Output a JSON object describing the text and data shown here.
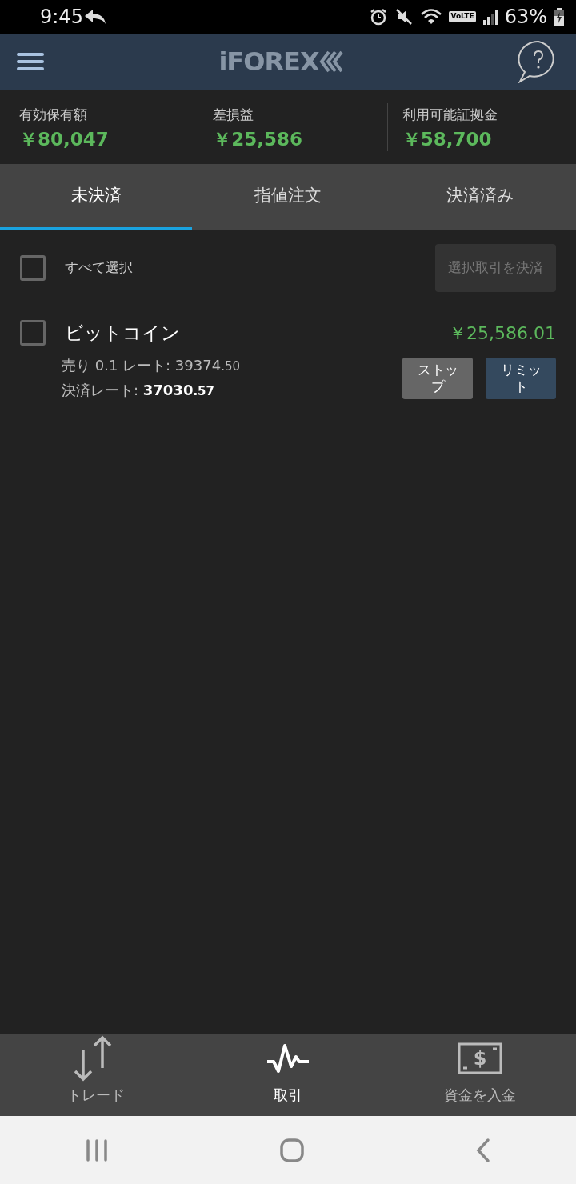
{
  "status_bar": {
    "time": "9:45",
    "network": "VoLTE",
    "battery": "63%"
  },
  "header": {
    "logo": "iFOREX"
  },
  "summary": [
    {
      "label": "有効保有額",
      "value": "￥80,047"
    },
    {
      "label": "差損益",
      "value": "￥25,586"
    },
    {
      "label": "利用可能証拠金",
      "value": "￥58,700"
    }
  ],
  "tabs": [
    {
      "label": "未決済",
      "selected": true
    },
    {
      "label": "指値注文",
      "selected": false
    },
    {
      "label": "決済済み",
      "selected": false
    }
  ],
  "select_all": {
    "label": "すべて選択",
    "checked": false,
    "button": "選択取引を決済",
    "button_disabled": true
  },
  "positions": [
    {
      "name": "ビットコイン",
      "checked": false,
      "pnl": "￥25,586.01",
      "open_prefix": "売り 0.1 レート: ",
      "open_main": "39374",
      "open_decimals": ".50",
      "close_prefix": "決済レート: ",
      "close_main": "37030",
      "close_decimals": ".57",
      "stop": "ストップ",
      "limit": "リミット"
    }
  ],
  "bottom_nav": [
    {
      "label": "トレード",
      "kind": "trade",
      "selected": false
    },
    {
      "label": "取引",
      "kind": "activity",
      "selected": true
    },
    {
      "label": "資金を入金",
      "kind": "deposit",
      "icon_text": "$",
      "selected": false
    }
  ]
}
